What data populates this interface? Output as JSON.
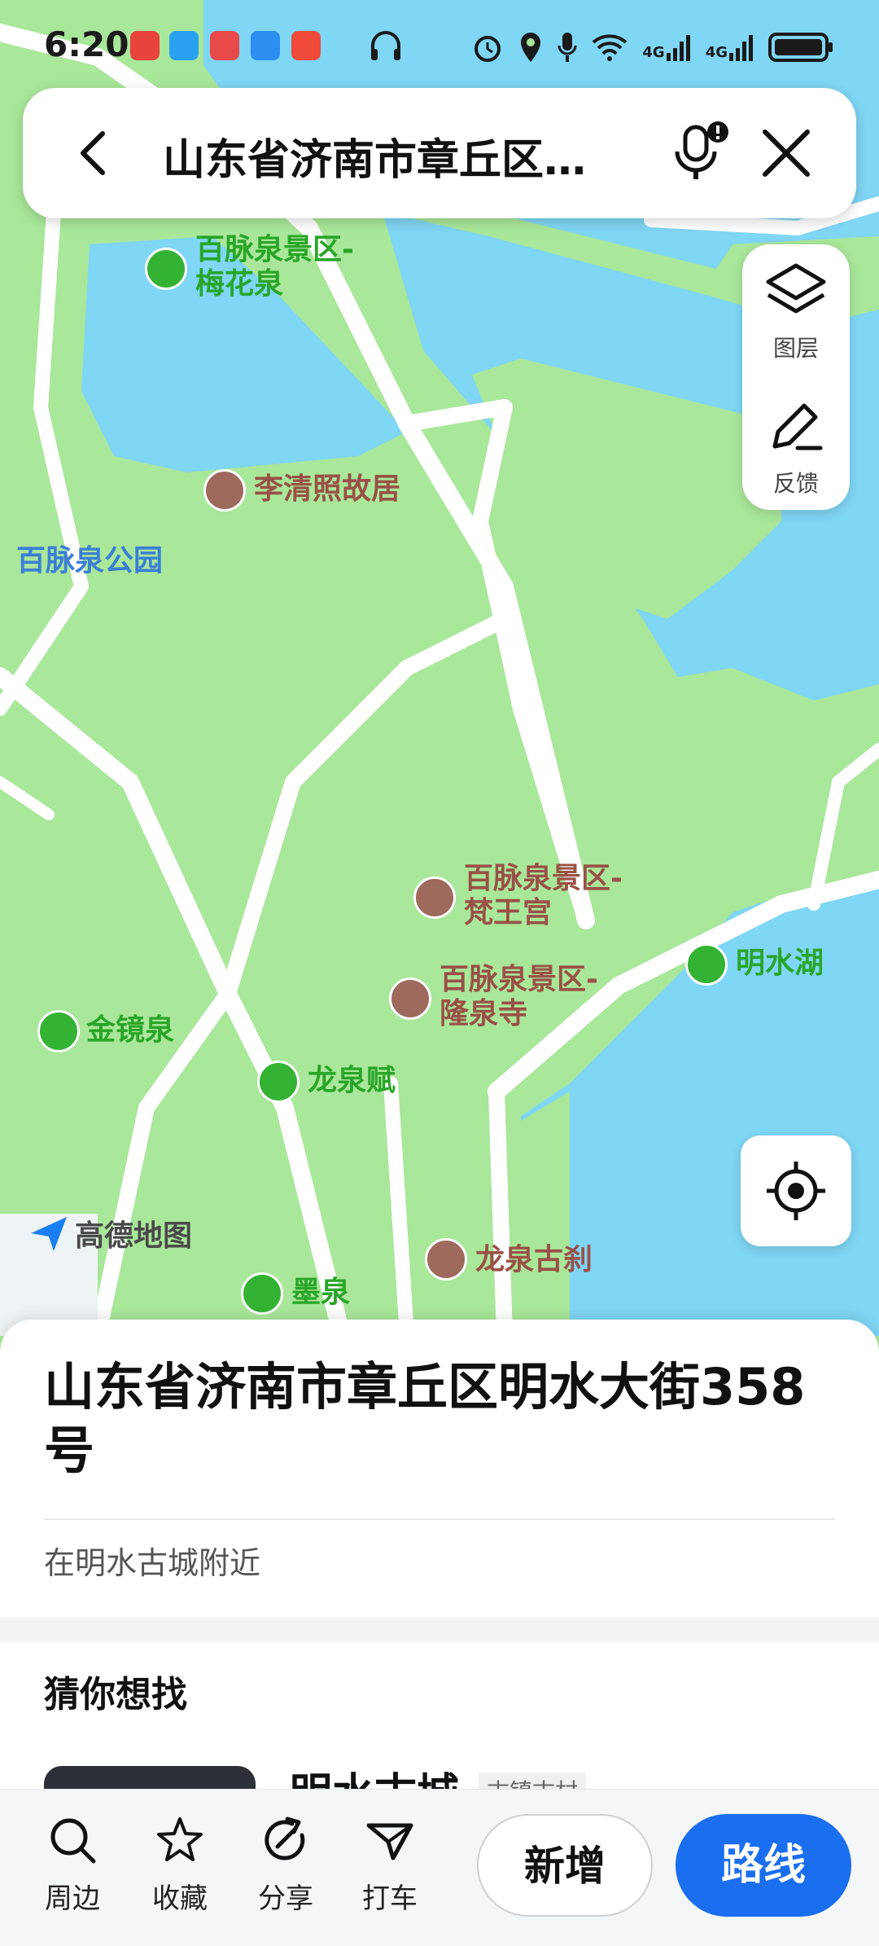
{
  "status_bar": {
    "time": "6:20",
    "network_1": "4G",
    "network_2": "4G"
  },
  "search_bar": {
    "query": "山东省济南市章丘区…"
  },
  "map_controls": {
    "layers_label": "图层",
    "feedback_label": "反馈"
  },
  "map_labels": {
    "pois": [
      {
        "name_line1": "百脉泉景区-",
        "name_line2": "梅花泉",
        "type": "green"
      },
      {
        "name_line1": "李清照故居",
        "name_line2": "",
        "type": "brown"
      },
      {
        "name_line1": "百脉泉公园",
        "name_line2": "",
        "type": "blue"
      },
      {
        "name_line1": "百脉泉景区-",
        "name_line2": "梵王宫",
        "type": "brown"
      },
      {
        "name_line1": "明水湖",
        "name_line2": "",
        "type": "green"
      },
      {
        "name_line1": "百脉泉景区-",
        "name_line2": "隆泉寺",
        "type": "brown"
      },
      {
        "name_line1": "金镜泉",
        "name_line2": "",
        "type": "green"
      },
      {
        "name_line1": "龙泉赋",
        "name_line2": "",
        "type": "green"
      },
      {
        "name_line1": "龙泉古刹",
        "name_line2": "",
        "type": "brown"
      },
      {
        "name_line1": "墨泉",
        "name_line2": "",
        "type": "green"
      }
    ],
    "brand": "高德地图"
  },
  "place_sheet": {
    "address": "山东省济南市章丘区明水大街358号",
    "nearby": "在明水古城附近",
    "guess_title": "猜你想找",
    "recommend": {
      "name": "明水古城",
      "tag": "古镇古村"
    }
  },
  "bottom_bar": {
    "items": [
      {
        "label": "周边",
        "icon": "search-icon"
      },
      {
        "label": "收藏",
        "icon": "star-icon"
      },
      {
        "label": "分享",
        "icon": "share-icon"
      },
      {
        "label": "打车",
        "icon": "taxi-icon"
      }
    ],
    "add_label": "新增",
    "route_label": "路线"
  },
  "colors": {
    "water": "#7fd6f5",
    "park": "#a9e79a",
    "road": "#ffffff",
    "accent": "#1a6ef0"
  }
}
